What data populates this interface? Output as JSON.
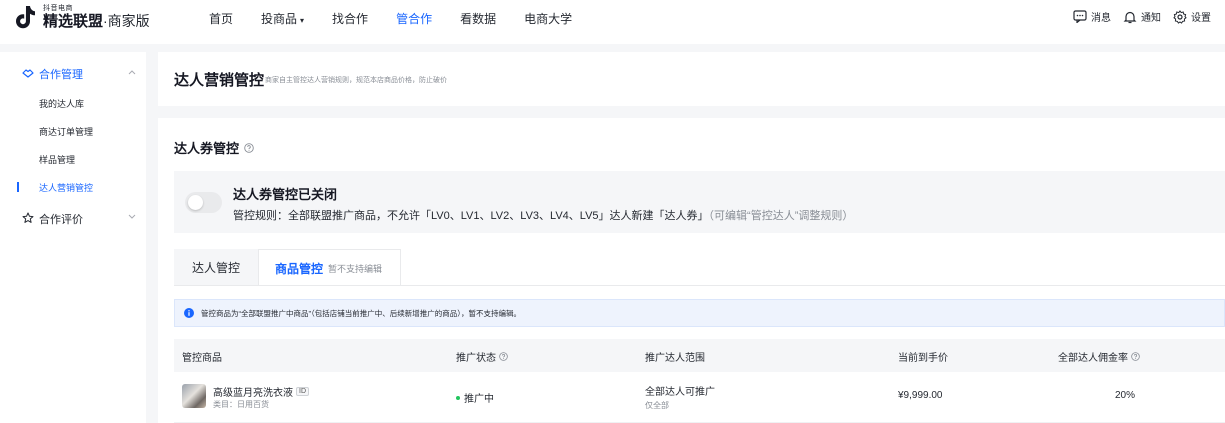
{
  "brand": {
    "small": "抖音电商",
    "name": "精选联盟",
    "edition": "·商家版"
  },
  "nav": {
    "items": [
      {
        "label": "首页"
      },
      {
        "label": "投商品"
      },
      {
        "label": "找合作"
      },
      {
        "label": "管合作"
      },
      {
        "label": "看数据"
      },
      {
        "label": "电商大学"
      }
    ],
    "dropdown_caret": "▾"
  },
  "toolbar": {
    "messages": "消息",
    "notifications": "通知",
    "settings": "设置"
  },
  "sidebar": {
    "group_manage": "合作管理",
    "items": [
      {
        "label": "我的达人库"
      },
      {
        "label": "商达订单管理"
      },
      {
        "label": "样品管理"
      },
      {
        "label": "达人营销管控"
      }
    ],
    "group_review": "合作评价"
  },
  "page": {
    "title": "达人营销管控",
    "description": "商家自主管控达人营销规则，规范本店商品价格，防止破价"
  },
  "section": {
    "title": "达人券管控"
  },
  "status": {
    "title": "达人券管控已关闭",
    "rule": "管控规则：全部联盟推广商品，不允许「LV0、LV1、LV2、LV3、LV4、LV5」达人新建「达人券」",
    "hint": "（可编辑“管控达人”调整规则）"
  },
  "tabs": {
    "talent": "达人管控",
    "product": "商品管控",
    "product_note": "暂不支持编辑"
  },
  "notice": {
    "text": "管控商品为“全部联盟推广中商品”（包括店铺当前推广中、后续新增推广的商品），暂不支持编辑。"
  },
  "table": {
    "headers": {
      "product": "管控商品",
      "status": "推广状态",
      "range": "推广达人范围",
      "price": "当前到手价",
      "commission": "全部达人佣金率"
    },
    "rows": [
      {
        "name": "高级蓝月亮洗衣液",
        "id_tag": "ID",
        "category": "类目：日用百货",
        "status": "推广中",
        "range": "全部达人可推广",
        "range_sub": "仅全部",
        "price": "¥9,999.00",
        "commission": "20%"
      }
    ]
  }
}
